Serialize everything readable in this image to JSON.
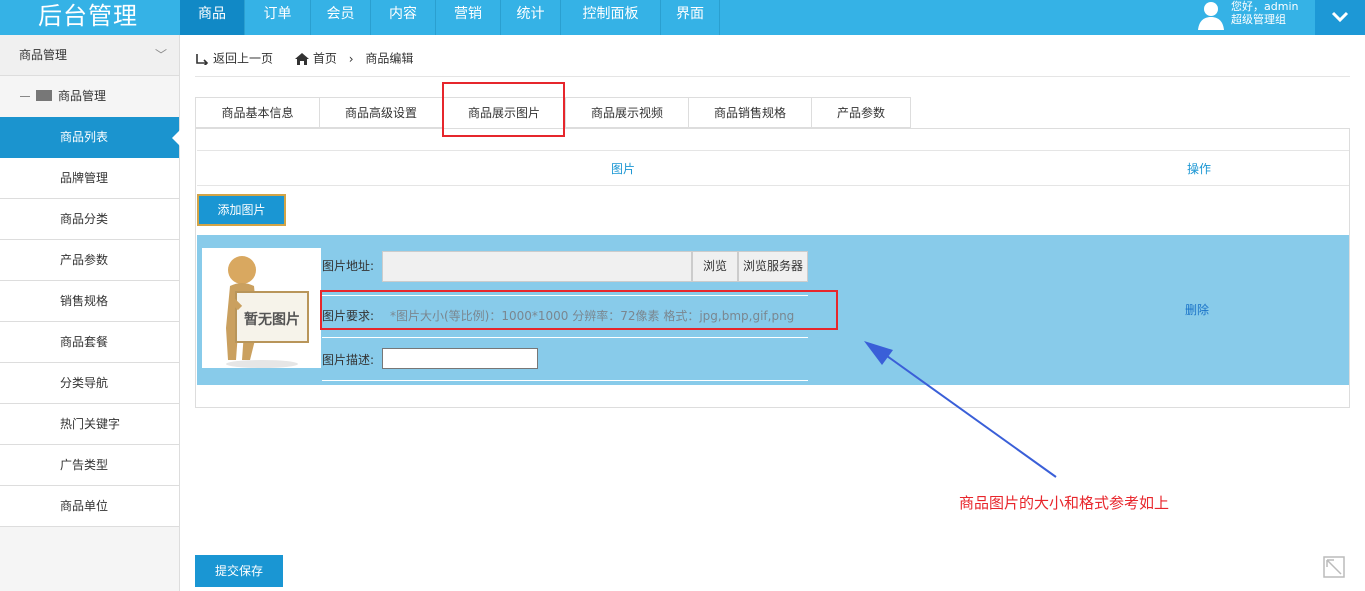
{
  "app": {
    "title": "后台管理"
  },
  "nav": [
    {
      "label": "商品",
      "active": true
    },
    {
      "label": "订单"
    },
    {
      "label": "会员"
    },
    {
      "label": "内容"
    },
    {
      "label": "营销"
    },
    {
      "label": "统计"
    },
    {
      "label": "控制面板"
    },
    {
      "label": "界面"
    }
  ],
  "user": {
    "greeting": "您好，admin",
    "role": "超级管理组"
  },
  "sidebar": {
    "group": "商品管理",
    "sub": "商品管理",
    "items": [
      {
        "label": "商品列表",
        "active": true
      },
      {
        "label": "品牌管理"
      },
      {
        "label": "商品分类"
      },
      {
        "label": "产品参数"
      },
      {
        "label": "销售规格"
      },
      {
        "label": "商品套餐"
      },
      {
        "label": "分类导航"
      },
      {
        "label": "热门关键字"
      },
      {
        "label": "广告类型"
      },
      {
        "label": "商品单位"
      }
    ]
  },
  "breadcrumb": {
    "back": "返回上一页",
    "home": "首页",
    "current": "商品编辑"
  },
  "tabs": [
    {
      "label": "商品基本信息"
    },
    {
      "label": "商品高级设置"
    },
    {
      "label": "商品展示图片",
      "active": true
    },
    {
      "label": "商品展示视频"
    },
    {
      "label": "商品销售规格"
    },
    {
      "label": "产品参数"
    }
  ],
  "table": {
    "col_image": "图片",
    "col_action": "操作",
    "add_button": "添加图片",
    "placeholder_text": "暂无图片",
    "url_label": "图片地址:",
    "url_value": "",
    "browse_button": "浏览",
    "browse_server_button": "浏览服务器",
    "req_label": "图片要求:",
    "req_text": "*图片大小(等比例)：1000*1000 分辨率：72像素 格式：jpg,bmp,gif,png",
    "desc_label": "图片描述:",
    "desc_value": "",
    "delete_link": "删除"
  },
  "annotation": {
    "note": "商品图片的大小和格式参考如上"
  },
  "footer": {
    "submit_button": "提交保存"
  },
  "colors": {
    "topbar": "#35b2e6",
    "active_nav": "#1189c6",
    "row_bg": "#88cbea",
    "highlight": "#e6262c",
    "primary": "#1a96d3"
  }
}
